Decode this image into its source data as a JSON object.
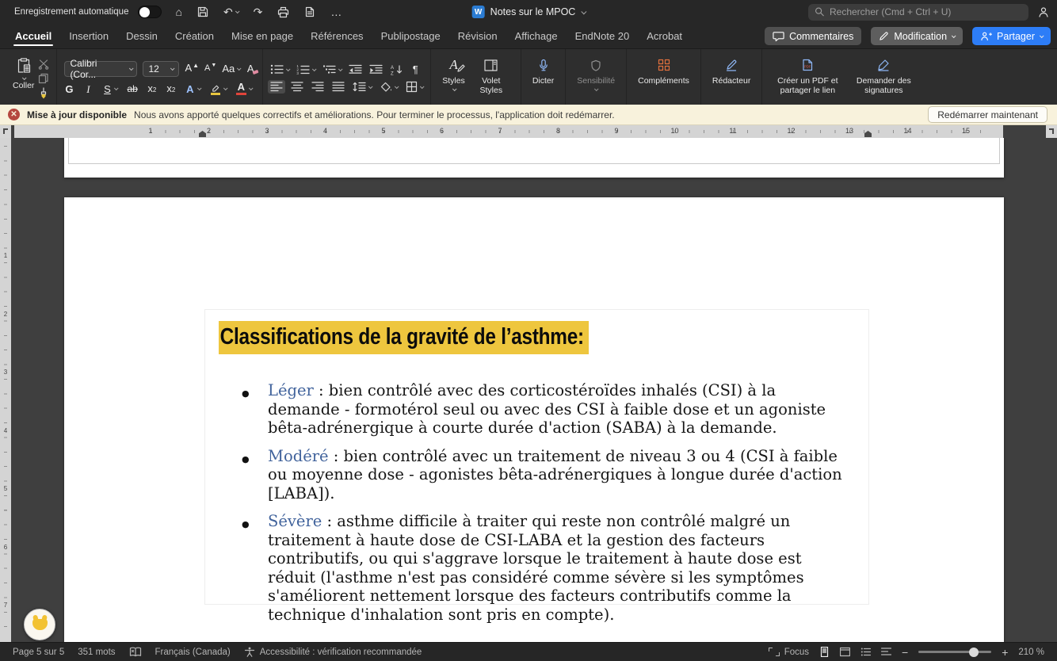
{
  "colors": {
    "accent_blue": "#2d7df7",
    "title_highlight": "#eec63e",
    "keyword_blue": "#41639c",
    "notification_bg": "#f8f2dc",
    "notification_close": "#b5473f"
  },
  "icons": {
    "home_glyph": "⌂",
    "undo_glyph": "↶",
    "redo_glyph": "↷",
    "more_glyph": "…",
    "word_glyph": "W",
    "pilcrow_glyph": "¶",
    "zoom_out_glyph": "−",
    "zoom_in_glyph": "+"
  },
  "titlebar": {
    "autosave_label": "Enregistrement automatique",
    "doc_title": "Notes sur le MPOC",
    "search_placeholder": "Rechercher (Cmd + Ctrl + U)"
  },
  "tabs": {
    "items": [
      {
        "label": "Accueil",
        "active": true
      },
      {
        "label": "Insertion"
      },
      {
        "label": "Dessin"
      },
      {
        "label": "Création"
      },
      {
        "label": "Mise en page"
      },
      {
        "label": "Références"
      },
      {
        "label": "Publipostage"
      },
      {
        "label": "Révision"
      },
      {
        "label": "Affichage"
      },
      {
        "label": "EndNote 20"
      },
      {
        "label": "Acrobat"
      }
    ],
    "comments_label": "Commentaires",
    "editing_label": "Modification",
    "share_label": "Partager"
  },
  "ribbon": {
    "paste_label": "Coller",
    "font_name": "Calibri (Cor...",
    "font_size": "12",
    "grow_glyph": "A",
    "shrink_glyph": "A",
    "case_glyph": "Aa",
    "clear_glyph": "A",
    "bold_glyph": "G",
    "italic_glyph": "I",
    "underline_glyph": "S",
    "strike_glyph": "ab",
    "sub_glyph": "x",
    "sup_glyph": "x",
    "script_digit": "2",
    "effects_glyph": "A",
    "fontcolor_glyph": "A",
    "styles_glyph": "A",
    "styles_label": "Styles",
    "styles_pane_label": "Volet Styles",
    "dictate_label": "Dicter",
    "sensitivity_label": "Sensibilité",
    "addins_label": "Compléments",
    "editor_label": "Rédacteur",
    "pdf_label": "Créer un PDF et partager le lien",
    "signatures_label": "Demander des signatures"
  },
  "notification": {
    "badge": "Mise à jour disponible",
    "message": "Nous avons apporté quelques correctifs et améliorations. Pour terminer le processus, l'application doit redémarrer.",
    "action_label": "Redémarrer maintenant"
  },
  "ruler": {
    "h_numbers": [
      "1",
      "2",
      "3",
      "4",
      "5",
      "6",
      "7",
      "8",
      "9",
      "10",
      "11",
      "12",
      "13",
      "14",
      "15"
    ],
    "v_numbers": [
      "1",
      "2",
      "3",
      "4",
      "5",
      "6",
      "7"
    ]
  },
  "document": {
    "slide": {
      "title": "Classifications de la gravité de l’asthme:",
      "bullets": [
        {
          "term": "Léger",
          "text": " : bien contrôlé avec des corticostéroïdes inhalés (CSI) à la demande - formotérol seul ou avec des CSI à faible dose et un agoniste bêta-adrénergique à courte durée d'action (SABA) à la demande."
        },
        {
          "term": "Modéré",
          "text": " : bien contrôlé avec un traitement de niveau 3 ou 4 (CSI à faible ou moyenne dose - agonistes bêta-adrénergiques à longue durée d'action [LABA])."
        },
        {
          "term": "Sévère",
          "text": " : asthme difficile à traiter qui reste non contrôlé malgré un traitement à haute dose de CSI-LABA et la gestion des facteurs contributifs, ou qui s'aggrave lorsque le traitement à haute dose est réduit (l'asthme n'est pas considéré comme sévère si les symptômes s'améliorent nettement lorsque des facteurs contributifs comme la technique d'inhalation sont pris en compte)."
        }
      ]
    }
  },
  "statusbar": {
    "page_label": "Page 5 sur 5",
    "word_count": "351 mots",
    "language": "Français (Canada)",
    "accessibility": "Accessibilité : vérification recommandée",
    "focus_label": "Focus",
    "zoom_level": "210 %"
  }
}
